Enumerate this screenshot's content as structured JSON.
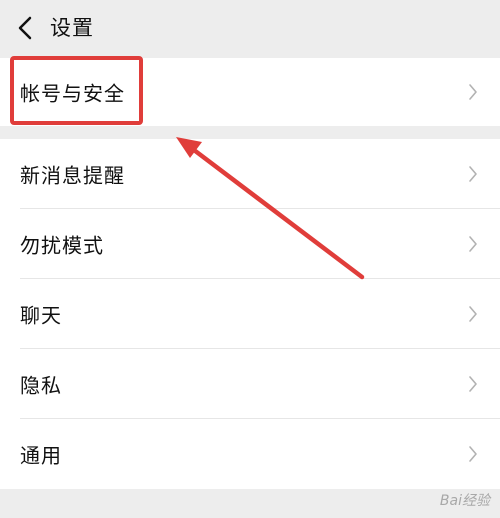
{
  "nav": {
    "title": "设置"
  },
  "groups": [
    {
      "items": [
        {
          "label": "帐号与安全"
        }
      ]
    },
    {
      "items": [
        {
          "label": "新消息提醒"
        },
        {
          "label": "勿扰模式"
        },
        {
          "label": "聊天"
        },
        {
          "label": "隐私"
        },
        {
          "label": "通用"
        }
      ]
    }
  ],
  "annotation": {
    "highlight_color": "#e03d3a",
    "arrow_color": "#e03d3a"
  },
  "watermark": {
    "text": "Bai经验"
  }
}
